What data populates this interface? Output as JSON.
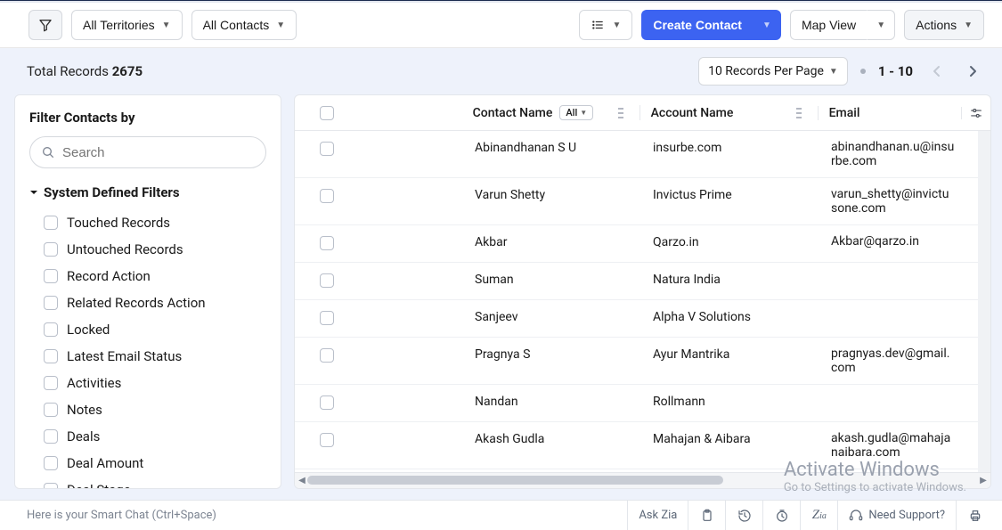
{
  "toolbar": {
    "territories_label": "All Territories",
    "contacts_label": "All Contacts",
    "create_label": "Create Contact",
    "mapview_label": "Map View",
    "actions_label": "Actions"
  },
  "summary": {
    "total_records_label": "Total Records",
    "total_records_value": "2675",
    "rpp_label": "10 Records Per Page",
    "range_label": "1 - 10"
  },
  "filter": {
    "title": "Filter Contacts by",
    "search_placeholder": "Search",
    "section_label": "System Defined Filters",
    "items": [
      {
        "label": "Touched Records"
      },
      {
        "label": "Untouched Records"
      },
      {
        "label": "Record Action"
      },
      {
        "label": "Related Records Action"
      },
      {
        "label": "Locked"
      },
      {
        "label": "Latest Email Status"
      },
      {
        "label": "Activities"
      },
      {
        "label": "Notes"
      },
      {
        "label": "Deals"
      },
      {
        "label": "Deal Amount"
      },
      {
        "label": "Deal Stage"
      }
    ]
  },
  "columns": {
    "contact_name": "Contact Name",
    "all_pill": "All",
    "account_name": "Account Name",
    "email": "Email"
  },
  "rows": [
    {
      "name": "Abinandhanan S U",
      "account": "insurbe.com",
      "email": "abinandhanan.u@insurbe.com"
    },
    {
      "name": "Varun Shetty",
      "account": "Invictus Prime",
      "email": "varun_shetty@invictusone.com"
    },
    {
      "name": "Akbar",
      "account": "Qarzo.in",
      "email": "Akbar@qarzo.in"
    },
    {
      "name": "Suman",
      "account": "Natura India",
      "email": ""
    },
    {
      "name": "Sanjeev",
      "account": "Alpha V Solutions",
      "email": ""
    },
    {
      "name": "Pragnya S",
      "account": "Ayur Mantrika",
      "email": "pragnyas.dev@gmail.com"
    },
    {
      "name": "Nandan",
      "account": "Rollmann",
      "email": ""
    },
    {
      "name": "Akash Gudla",
      "account": "Mahajan & Aibara",
      "email": "akash.gudla@mahajanaibara.com"
    }
  ],
  "watermark": {
    "title": "Activate Windows",
    "subtitle": "Go to Settings to activate Windows."
  },
  "footer": {
    "hint": "Here is your Smart Chat (Ctrl+Space)",
    "ask_zia": "Ask Zia",
    "support": "Need Support?"
  }
}
